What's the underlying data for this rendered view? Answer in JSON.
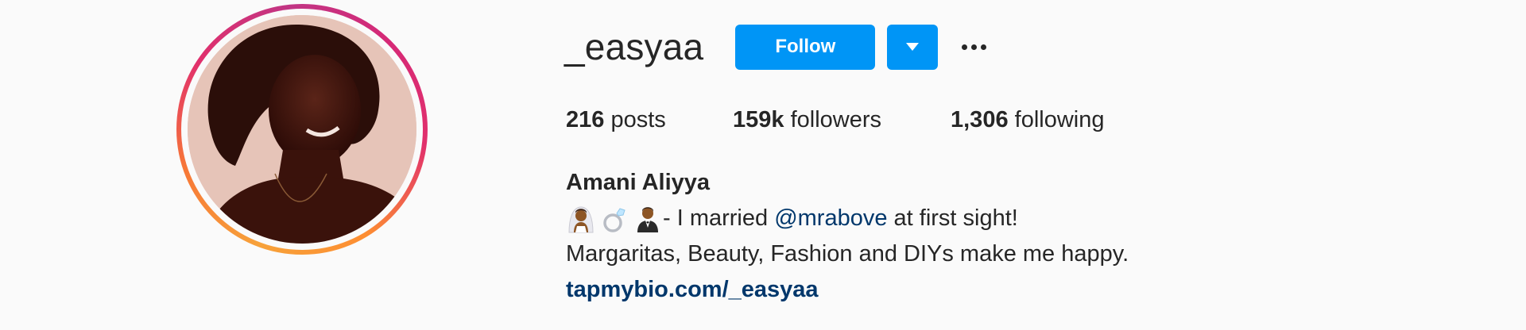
{
  "profile": {
    "username": "_easyaa",
    "follow_label": "Follow",
    "stats": {
      "posts_count": "216",
      "posts_label": "posts",
      "followers_count": "159k",
      "followers_label": "followers",
      "following_count": "1,306",
      "following_label": "following"
    },
    "full_name": "Amani Aliyya",
    "bio": {
      "emojis": [
        "bride-with-veil-icon",
        "ring-icon",
        "groom-in-tuxedo-icon"
      ],
      "line1_prefix": "- I married ",
      "mention": "@mrabove",
      "line1_suffix": " at first sight!",
      "line2": "Margaritas, Beauty, Fashion and DIYs make me happy.",
      "link": "tapmybio.com/_easyaa"
    }
  },
  "colors": {
    "background": "#fafafa",
    "primary_button": "#0095f6",
    "text": "#262626",
    "link": "#00376b"
  }
}
